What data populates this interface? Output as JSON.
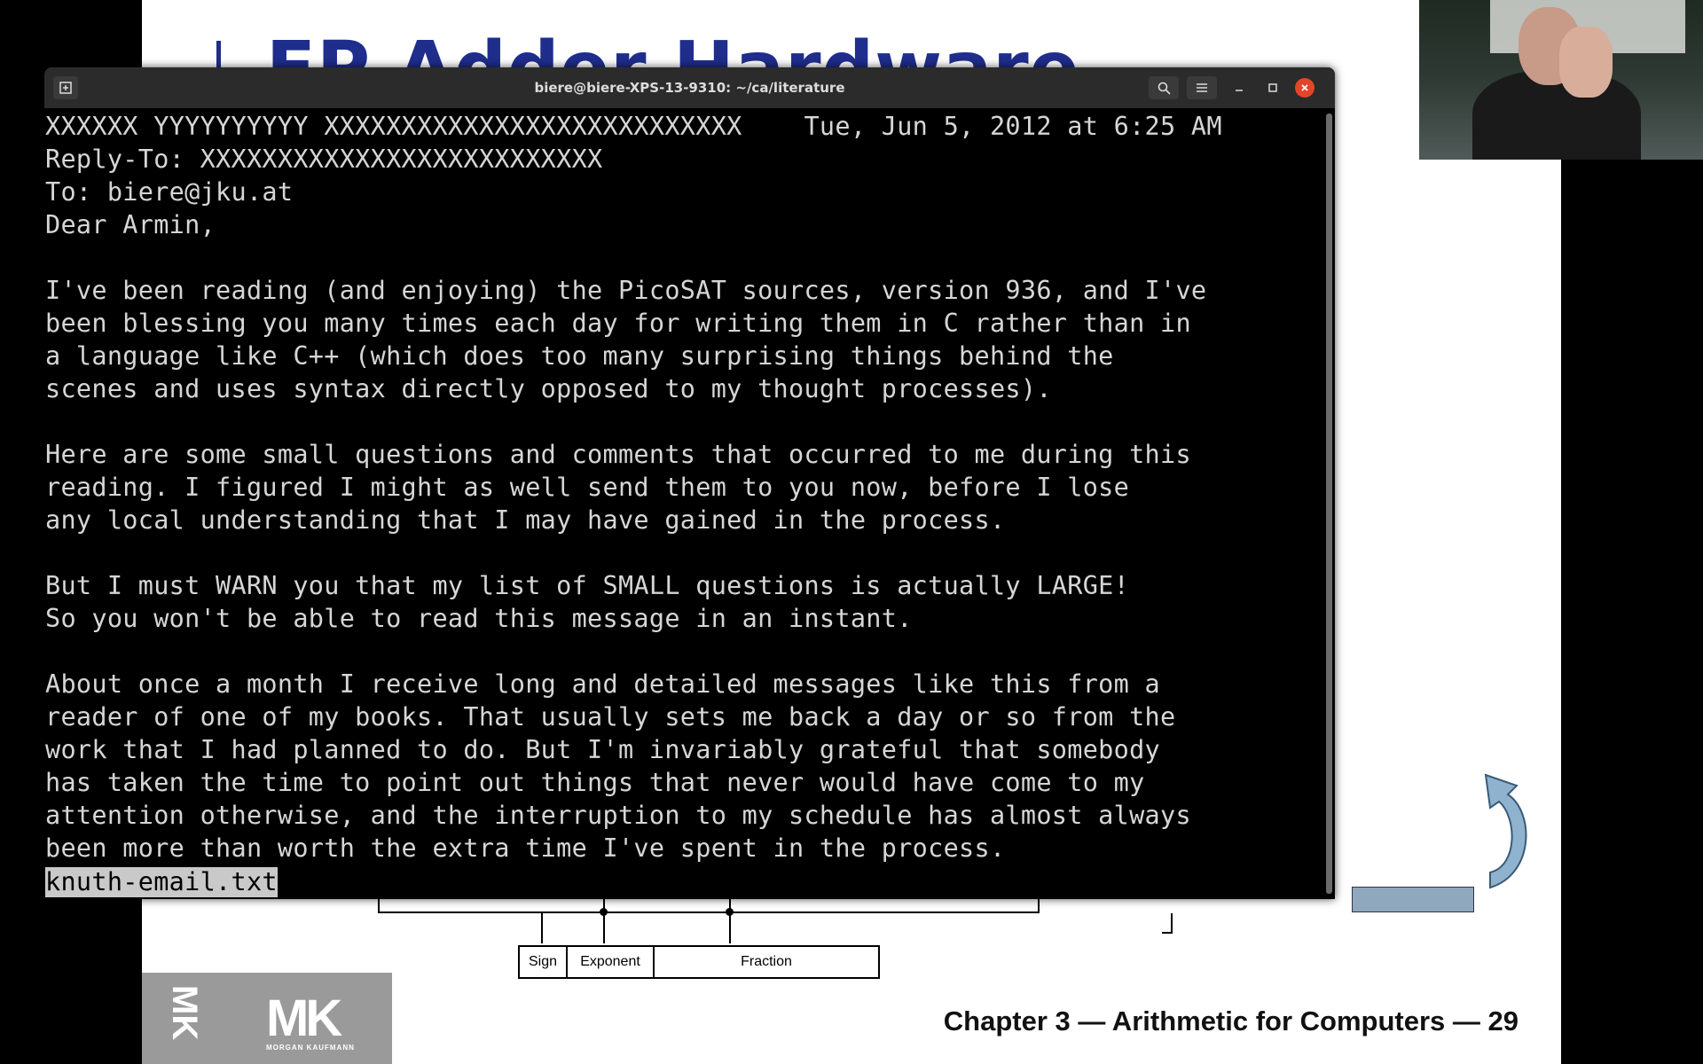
{
  "slide": {
    "title": "FP Adder Hardware",
    "footer": "Chapter 3 — Arithmetic for Computers — 29",
    "logo_vertical": "MK",
    "logo_mark": "MK",
    "logo_caption": "MORGAN KAUFMANN",
    "fields": {
      "sign": "Sign",
      "exponent": "Exponent",
      "fraction": "Fraction"
    }
  },
  "terminal": {
    "title": "biere@biere-XPS-13-9310: ~/ca/literature",
    "status_file": "knuth-email.txt",
    "lines": [
      "XXXXXX YYYYYYYYYY XXXXXXXXXXXXXXXXXXXXXXXXXXX    Tue, Jun 5, 2012 at 6:25 AM",
      "Reply-To: XXXXXXXXXXXXXXXXXXXXXXXXXX",
      "To: biere@jku.at",
      "Dear Armin,",
      "",
      "I've been reading (and enjoying) the PicoSAT sources, version 936, and I've",
      "been blessing you many times each day for writing them in C rather than in",
      "a language like C++ (which does too many surprising things behind the",
      "scenes and uses syntax directly opposed to my thought processes).",
      "",
      "Here are some small questions and comments that occurred to me during this",
      "reading. I figured I might as well send them to you now, before I lose",
      "any local understanding that I may have gained in the process.",
      "",
      "But I must WARN you that my list of SMALL questions is actually LARGE!",
      "So you won't be able to read this message in an instant.",
      "",
      "About once a month I receive long and detailed messages like this from a",
      "reader of one of my books. That usually sets me back a day or so from the",
      "work that I had planned to do. But I'm invariably grateful that somebody",
      "has taken the time to point out things that never would have come to my",
      "attention otherwise, and the interruption to my schedule has almost always",
      "been more than worth the extra time I've spent in the process."
    ]
  },
  "icons": {
    "new_tab": "new-tab-icon",
    "search": "search-icon",
    "menu": "hamburger-menu-icon",
    "minimize": "minimize-icon",
    "maximize": "maximize-icon",
    "close": "close-icon"
  }
}
